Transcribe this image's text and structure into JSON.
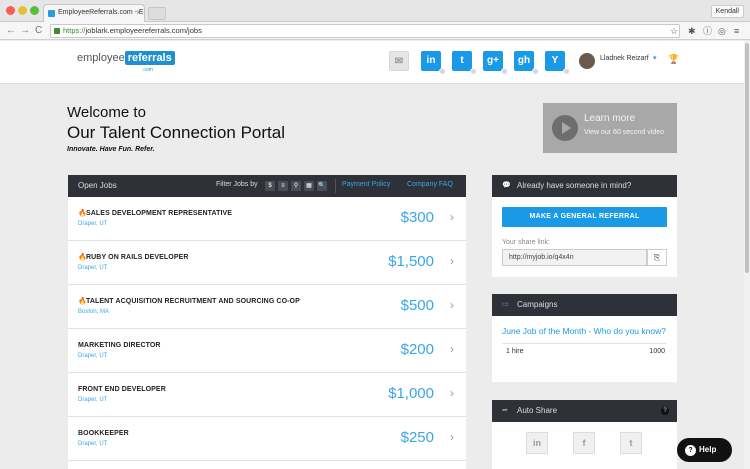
{
  "browser": {
    "tab_title": "EmployeeReferrals.com - E",
    "tab_close": "×",
    "profile": "Kendall",
    "url_scheme": "https://",
    "url_rest": "joblark.employeereferrals.com/jobs",
    "back": "←",
    "forward": "→",
    "reload": "C",
    "star": "☆",
    "ext1": "✱",
    "ext2": "ⓘ",
    "ext3": "◎",
    "menu": "≡"
  },
  "header": {
    "logo_text": "employee",
    "logo_badge": "referrals",
    "logo_sub": ".com",
    "mail_icon": "✉",
    "socials": [
      {
        "label": "in",
        "name": "linkedin"
      },
      {
        "label": "t",
        "name": "twitter"
      },
      {
        "label": "g+",
        "name": "google-plus"
      },
      {
        "label": "gh",
        "name": "github"
      },
      {
        "label": "Y",
        "name": "ycombinator"
      }
    ],
    "user_name": "Lladnek Reizarf",
    "caret": "▾",
    "trophy": "🏆"
  },
  "welcome": {
    "line1": "Welcome to",
    "line2": "Our Talent Connection Portal",
    "tagline": "Innovate. Have Fun. Refer."
  },
  "video": {
    "title": "Learn more",
    "subtitle": "View our 60 second video"
  },
  "jobs_panel": {
    "title": "Open Jobs",
    "filter_label": "Filter Jobs by",
    "filter_icons": [
      "$",
      "≡",
      "⚲",
      "▦",
      "🔍"
    ],
    "payment_policy": "Payment Policy",
    "company_faq": "Company FAQ",
    "jobs": [
      {
        "title": "SALES DEVELOPMENT REPRESENTATIVE",
        "location": "Draper, UT",
        "amount": "$300",
        "hot": true
      },
      {
        "title": "RUBY ON RAILS DEVELOPER",
        "location": "Draper, UT",
        "amount": "$1,500",
        "hot": true
      },
      {
        "title": "TALENT ACQUISITION RECRUITMENT AND SOURCING CO-OP",
        "location": "Boston, MA",
        "amount": "$500",
        "hot": true
      },
      {
        "title": "MARKETING DIRECTOR",
        "location": "Draper, UT",
        "amount": "$200",
        "hot": false
      },
      {
        "title": "FRONT END DEVELOPER",
        "location": "Draper, UT",
        "amount": "$1,000",
        "hot": false
      },
      {
        "title": "BOOKKEEPER",
        "location": "Draper, UT",
        "amount": "$250",
        "hot": false
      }
    ],
    "chevron": "›",
    "flame": "🔥"
  },
  "referral_panel": {
    "title": "Already have someone in mind?",
    "icon": "💬",
    "button": "MAKE A GENERAL REFERRAL",
    "share_label": "Your share link:",
    "share_link": "http://myjob.io/q4x4n",
    "copy_icon": "⎘"
  },
  "campaigns_panel": {
    "title": "Campaigns",
    "icon": "▭",
    "campaign_title": "June Job of the Month - Who do you know?",
    "hires": "1 hire",
    "points": "1000"
  },
  "autoshare_panel": {
    "title": "Auto Share",
    "icon": "➦",
    "help": "?",
    "networks": [
      "in",
      "f",
      "t"
    ]
  },
  "help_button": {
    "label": "Help",
    "icon": "?"
  }
}
